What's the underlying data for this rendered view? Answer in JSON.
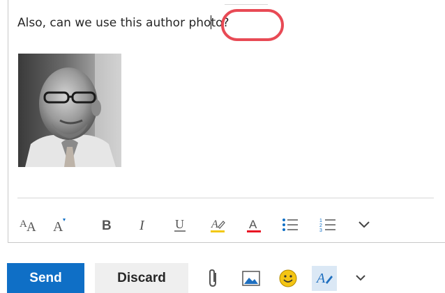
{
  "message": {
    "text_before_caret": "Also, can we use this author pho",
    "text_after_caret": "to?"
  },
  "author_photo": {
    "alt": "author photo"
  },
  "format_toolbar": {
    "buttons": [
      {
        "name": "font-size-icon",
        "glyph": "AA"
      },
      {
        "name": "grow-font-icon",
        "glyph": "A"
      },
      {
        "name": "bold-icon",
        "glyph": "B"
      },
      {
        "name": "italic-icon",
        "glyph": "I"
      },
      {
        "name": "underline-icon",
        "glyph": "U"
      },
      {
        "name": "highlight-icon",
        "color": "#f2c811"
      },
      {
        "name": "font-color-icon",
        "color": "#e81123"
      },
      {
        "name": "bullets-icon"
      },
      {
        "name": "numbering-icon"
      },
      {
        "name": "more-options-chevron-icon"
      }
    ]
  },
  "actions": {
    "send_label": "Send",
    "discard_label": "Discard",
    "icons": [
      "paperclip-icon",
      "picture-icon",
      "emoji-icon",
      "format-text-icon",
      "chevron-down-icon"
    ]
  },
  "colors": {
    "accent": "#0f6fc6",
    "callout_ring": "#e84a55",
    "icon_gray": "#5a5a5a"
  }
}
